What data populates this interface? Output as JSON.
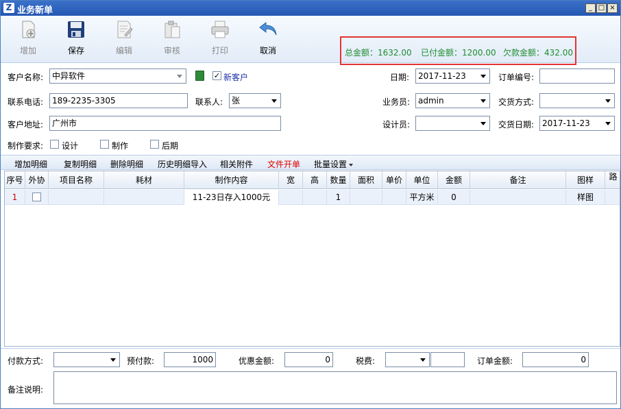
{
  "window": {
    "title": "业务新单",
    "app_icon_letter": "Z",
    "min_glyph": "_",
    "max_glyph": "□",
    "close_glyph": "×"
  },
  "toolbar": {
    "add": "增加",
    "save": "保存",
    "edit": "编辑",
    "audit": "审核",
    "print": "打印",
    "cancel": "取消"
  },
  "totals": {
    "total": "总金额：1632.00",
    "paid": "已付金额：1200.00",
    "owed": "欠款金额：432.00"
  },
  "form": {
    "customer_name_label": "客户名称:",
    "customer_name_value": "中异软件",
    "new_customer_label": "新客户",
    "date_label": "日期:",
    "date_value": "2017-11-23",
    "order_no_label": "订单编号:",
    "order_no_value": "",
    "phone_label": "联系电话:",
    "phone_value": "189-2235-3305",
    "contact_label": "联系人:",
    "contact_value": "张",
    "salesman_label": "业务员:",
    "salesman_value": "admin",
    "delivery_method_label": "交货方式:",
    "delivery_method_value": "",
    "address_label": "客户地址:",
    "address_value": "广州市",
    "designer_label": "设计员:",
    "designer_value": "",
    "delivery_date_label": "交货日期:",
    "delivery_date_value": "2017-11-23",
    "requirements_label": "制作要求:",
    "req_design": "设计",
    "req_make": "制作",
    "req_post": "后期"
  },
  "detail_toolbar": {
    "add_detail": "增加明细",
    "copy_detail": "复制明细",
    "delete_detail": "删除明细",
    "history_import": "历史明细导入",
    "attachments": "相关附件",
    "file_order": "文件开单",
    "batch_settings": "批量设置"
  },
  "grid": {
    "headers": [
      "序号",
      "外协",
      "项目名称",
      "耗材",
      "制作内容",
      "宽",
      "高",
      "数量",
      "面积",
      "单价",
      "单位",
      "金额",
      "备注",
      "图样",
      "路"
    ],
    "rows": [
      [
        "1",
        "",
        "",
        "",
        "11-23日存入1000元",
        "",
        "",
        "1",
        "",
        "",
        "平方米",
        "0",
        "",
        "样图",
        ""
      ]
    ]
  },
  "footer": {
    "payment_method_label": "付款方式:",
    "payment_method_value": "",
    "prepay_label": "预付款:",
    "prepay_value": "1000",
    "discount_label": "优惠金额:",
    "discount_value": "0",
    "tax_label": "税费:",
    "tax_value": "",
    "order_amount_label": "订单金额:",
    "order_amount_value": "0",
    "remarks_label": "备注说明:",
    "remarks_value": ""
  },
  "colors": {
    "title_bar": "#2457b3",
    "totals_text": "#1e8c2f",
    "highlight_border": "#e33333",
    "file_order_red": "#e00000",
    "grid_row": "#eaf1fb"
  }
}
